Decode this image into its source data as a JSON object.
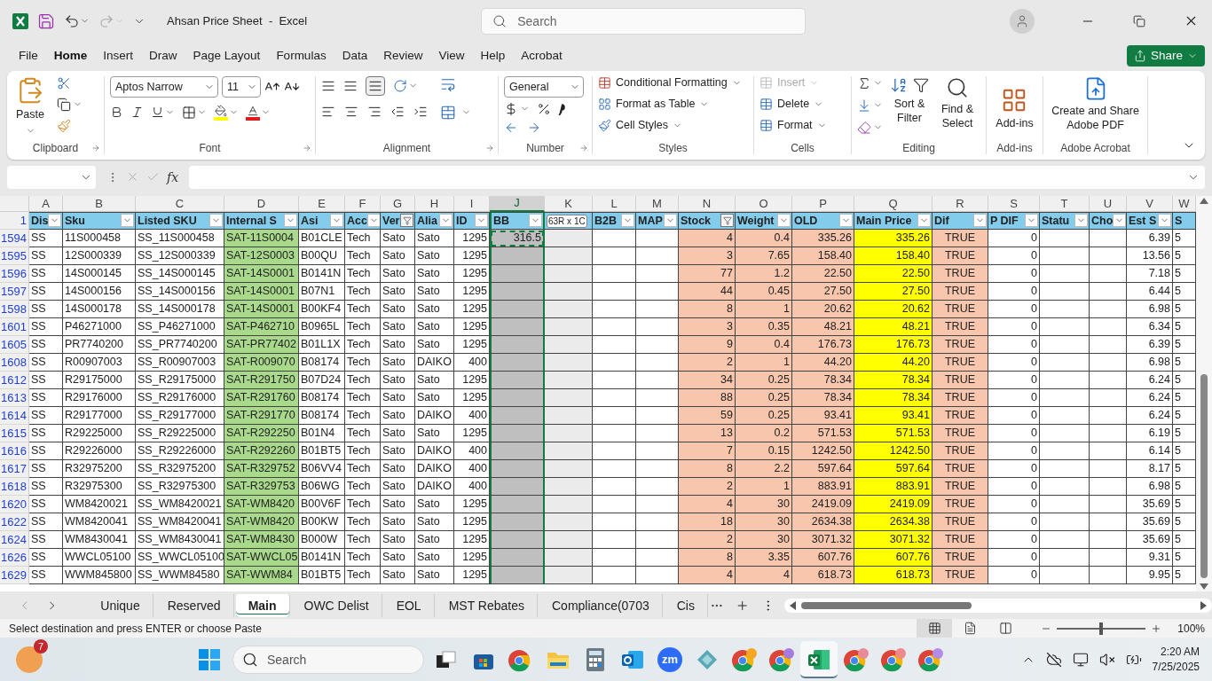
{
  "window": {
    "title": "Ahsan Price Sheet  -  Excel",
    "search_placeholder": "Search"
  },
  "menu_tabs": [
    {
      "label": "File",
      "selected": false
    },
    {
      "label": "Home",
      "selected": true
    },
    {
      "label": "Insert",
      "selected": false
    },
    {
      "label": "Draw",
      "selected": false
    },
    {
      "label": "Page Layout",
      "selected": false
    },
    {
      "label": "Formulas",
      "selected": false
    },
    {
      "label": "Data",
      "selected": false
    },
    {
      "label": "Review",
      "selected": false
    },
    {
      "label": "View",
      "selected": false
    },
    {
      "label": "Help",
      "selected": false
    },
    {
      "label": "Acrobat",
      "selected": false
    }
  ],
  "share_button": "Share",
  "ribbon": {
    "clipboard": {
      "label": "Clipboard",
      "paste": "Paste"
    },
    "font": {
      "label": "Font",
      "font_name": "Aptos Narrow",
      "font_size": "11"
    },
    "alignment": {
      "label": "Alignment"
    },
    "number": {
      "label": "Number",
      "format": "General"
    },
    "styles": {
      "label": "Styles",
      "items": [
        "Conditional Formatting",
        "Format as Table",
        "Cell Styles"
      ]
    },
    "cells": {
      "label": "Cells",
      "items": [
        {
          "label": "Insert",
          "disabled": true
        },
        {
          "label": "Delete",
          "disabled": false
        },
        {
          "label": "Format",
          "disabled": false
        }
      ]
    },
    "editing": {
      "label": "Editing",
      "sort": "Sort & Filter",
      "find": "Find & Select"
    },
    "addins": {
      "label": "Add-ins",
      "button": "Add-ins"
    },
    "acrobat": {
      "label": "Adobe Acrobat",
      "button": "Create and Share Adobe PDF"
    }
  },
  "formula_bar": {
    "fx": "fx"
  },
  "selection_tooltip": "63R x 1C",
  "table": {
    "columns": [
      {
        "letter": "A",
        "header": "Dis",
        "selected": false,
        "filtered": false
      },
      {
        "letter": "B",
        "header": "Sku",
        "selected": false,
        "filtered": false
      },
      {
        "letter": "C",
        "header": "Listed SKU",
        "selected": false,
        "filtered": false
      },
      {
        "letter": "D",
        "header": "Internal S",
        "selected": false,
        "filtered": false,
        "color": "#a9d98b"
      },
      {
        "letter": "E",
        "header": "Asi",
        "selected": false,
        "filtered": false
      },
      {
        "letter": "F",
        "header": "Acc",
        "selected": false,
        "filtered": false
      },
      {
        "letter": "G",
        "header": "Ver",
        "selected": false,
        "filtered": true
      },
      {
        "letter": "H",
        "header": "Alia",
        "selected": false,
        "filtered": false
      },
      {
        "letter": "I",
        "header": "ID",
        "selected": false,
        "filtered": false
      },
      {
        "letter": "J",
        "header": "BB",
        "selected": true,
        "filtered": false
      },
      {
        "letter": "K",
        "selected": false,
        "color": "#ebebeb"
      },
      {
        "letter": "L",
        "header": "B2B",
        "selected": false,
        "filtered": false
      },
      {
        "letter": "M",
        "header": "MAP",
        "selected": false,
        "filtered": false
      },
      {
        "letter": "N",
        "header": "Stock",
        "selected": false,
        "filtered": true,
        "color": "#f7c6ad"
      },
      {
        "letter": "O",
        "header": "Weight",
        "selected": false,
        "filtered": false,
        "color": "#f7c6ad"
      },
      {
        "letter": "P",
        "header": "OLD",
        "selected": false,
        "filtered": false,
        "color": "#f7c6ad"
      },
      {
        "letter": "Q",
        "header": "Main Price",
        "selected": false,
        "filtered": false,
        "color": "#ffff00"
      },
      {
        "letter": "R",
        "header": "Dif",
        "selected": false,
        "filtered": false,
        "color": "#f7c6ad"
      },
      {
        "letter": "S",
        "header": "P DIF",
        "selected": false,
        "filtered": false
      },
      {
        "letter": "T",
        "header": "Statu",
        "selected": false,
        "filtered": false
      },
      {
        "letter": "U",
        "header": "Cho",
        "selected": false,
        "filtered": false
      },
      {
        "letter": "V",
        "header": "Est S",
        "selected": false,
        "filtered": false
      },
      {
        "letter": "W",
        "header": "S",
        "selected": false
      }
    ],
    "header_row": "1",
    "rows": [
      {
        "row": "1594",
        "dist": "SS",
        "sku": "11S000458",
        "listed_sku": "SS_11S000458",
        "internal_sku": "SAT-11S0004",
        "asin": "B01CLE",
        "acct": "Tech",
        "vendor": "Sato",
        "alias": "Sato",
        "id": "1295",
        "bb": "316.5",
        "stock": "4",
        "weight": "0.4",
        "old": "335.26",
        "main_price": "335.26",
        "dif": "TRUE",
        "p_dif": "0",
        "est_s": "6.39",
        "col_w": "5"
      },
      {
        "row": "1595",
        "dist": "SS",
        "sku": "12S000339",
        "listed_sku": "SS_12S000339",
        "internal_sku": "SAT-12S0003",
        "asin": "B00QU",
        "acct": "Tech",
        "vendor": "Sato",
        "alias": "Sato",
        "id": "1295",
        "stock": "3",
        "weight": "7.65",
        "old": "158.40",
        "main_price": "158.40",
        "dif": "TRUE",
        "p_dif": "0",
        "est_s": "13.56",
        "col_w": "5"
      },
      {
        "row": "1596",
        "dist": "SS",
        "sku": "14S000145",
        "listed_sku": "SS_14S000145",
        "internal_sku": "SAT-14S0001",
        "asin": "B0141N",
        "acct": "Tech",
        "vendor": "Sato",
        "alias": "Sato",
        "id": "1295",
        "stock": "77",
        "weight": "1.2",
        "old": "22.50",
        "main_price": "22.50",
        "dif": "TRUE",
        "p_dif": "0",
        "est_s": "7.18",
        "col_w": "5"
      },
      {
        "row": "1597",
        "dist": "SS",
        "sku": "14S000156",
        "listed_sku": "SS_14S000156",
        "internal_sku": "SAT-14S0001",
        "asin": "B07N1",
        "acct": "Tech",
        "vendor": "Sato",
        "alias": "Sato",
        "id": "1295",
        "stock": "44",
        "weight": "0.45",
        "old": "27.50",
        "main_price": "27.50",
        "dif": "TRUE",
        "p_dif": "0",
        "est_s": "6.44",
        "col_w": "5"
      },
      {
        "row": "1598",
        "dist": "SS",
        "sku": "14S000178",
        "listed_sku": "SS_14S000178",
        "internal_sku": "SAT-14S0001",
        "asin": "B00KF4",
        "acct": "Tech",
        "vendor": "Sato",
        "alias": "Sato",
        "id": "1295",
        "stock": "8",
        "weight": "1",
        "old": "20.62",
        "main_price": "20.62",
        "dif": "TRUE",
        "p_dif": "0",
        "est_s": "6.98",
        "col_w": "5"
      },
      {
        "row": "1601",
        "dist": "SS",
        "sku": "P46271000",
        "listed_sku": "SS_P46271000",
        "internal_sku": "SAT-P462710",
        "asin": "B0965L",
        "acct": "Tech",
        "vendor": "Sato",
        "alias": "Sato",
        "id": "1295",
        "stock": "3",
        "weight": "0.35",
        "old": "48.21",
        "main_price": "48.21",
        "dif": "TRUE",
        "p_dif": "0",
        "est_s": "6.34",
        "col_w": "5"
      },
      {
        "row": "1605",
        "dist": "SS",
        "sku": "PR7740200",
        "listed_sku": "SS_PR7740200",
        "internal_sku": "SAT-PR77402",
        "asin": "B01L1X",
        "acct": "Tech",
        "vendor": "Sato",
        "alias": "Sato",
        "id": "1295",
        "stock": "9",
        "weight": "0.4",
        "old": "176.73",
        "main_price": "176.73",
        "dif": "TRUE",
        "p_dif": "0",
        "est_s": "6.39",
        "col_w": "5"
      },
      {
        "row": "1608",
        "dist": "SS",
        "sku": "R00907003",
        "listed_sku": "SS_R00907003",
        "internal_sku": "SAT-R009070",
        "asin": "B08174",
        "acct": "Tech",
        "vendor": "Sato",
        "alias": "DAIKO",
        "id": "400",
        "stock": "2",
        "weight": "1",
        "old": "44.20",
        "main_price": "44.20",
        "dif": "TRUE",
        "p_dif": "0",
        "est_s": "6.98",
        "col_w": "5"
      },
      {
        "row": "1612",
        "dist": "SS",
        "sku": "R29175000",
        "listed_sku": "SS_R29175000",
        "internal_sku": "SAT-R291750",
        "asin": "B07D24",
        "acct": "Tech",
        "vendor": "Sato",
        "alias": "Sato",
        "id": "1295",
        "stock": "34",
        "weight": "0.25",
        "old": "78.34",
        "main_price": "78.34",
        "dif": "TRUE",
        "p_dif": "0",
        "est_s": "6.24",
        "col_w": "5"
      },
      {
        "row": "1613",
        "dist": "SS",
        "sku": "R29176000",
        "listed_sku": "SS_R29176000",
        "internal_sku": "SAT-R291760",
        "asin": "B08174",
        "acct": "Tech",
        "vendor": "Sato",
        "alias": "Sato",
        "id": "1295",
        "stock": "88",
        "weight": "0.25",
        "old": "78.34",
        "main_price": "78.34",
        "dif": "TRUE",
        "p_dif": "0",
        "est_s": "6.24",
        "col_w": "5"
      },
      {
        "row": "1614",
        "dist": "SS",
        "sku": "R29177000",
        "listed_sku": "SS_R29177000",
        "internal_sku": "SAT-R291770",
        "asin": "B08174",
        "acct": "Tech",
        "vendor": "Sato",
        "alias": "DAIKO",
        "id": "400",
        "stock": "59",
        "weight": "0.25",
        "old": "93.41",
        "main_price": "93.41",
        "dif": "TRUE",
        "p_dif": "0",
        "est_s": "6.24",
        "col_w": "5"
      },
      {
        "row": "1615",
        "dist": "SS",
        "sku": "R29225000",
        "listed_sku": "SS_R29225000",
        "internal_sku": "SAT-R292250",
        "asin": "B01N4",
        "acct": "Tech",
        "vendor": "Sato",
        "alias": "Sato",
        "id": "1295",
        "stock": "13",
        "weight": "0.2",
        "old": "571.53",
        "main_price": "571.53",
        "dif": "TRUE",
        "p_dif": "0",
        "est_s": "6.19",
        "col_w": "5"
      },
      {
        "row": "1616",
        "dist": "SS",
        "sku": "R29226000",
        "listed_sku": "SS_R29226000",
        "internal_sku": "SAT-R292260",
        "asin": "B01BT5",
        "acct": "Tech",
        "vendor": "Sato",
        "alias": "DAIKO",
        "id": "400",
        "stock": "7",
        "weight": "0.15",
        "old": "1242.50",
        "main_price": "1242.50",
        "dif": "TRUE",
        "p_dif": "0",
        "est_s": "6.14",
        "col_w": "5"
      },
      {
        "row": "1617",
        "dist": "SS",
        "sku": "R32975200",
        "listed_sku": "SS_R32975200",
        "internal_sku": "SAT-R329752",
        "asin": "B06VV4",
        "acct": "Tech",
        "vendor": "Sato",
        "alias": "DAIKO",
        "id": "400",
        "stock": "8",
        "weight": "2.2",
        "old": "597.64",
        "main_price": "597.64",
        "dif": "TRUE",
        "p_dif": "0",
        "est_s": "8.17",
        "col_w": "5"
      },
      {
        "row": "1618",
        "dist": "SS",
        "sku": "R32975300",
        "listed_sku": "SS_R32975300",
        "internal_sku": "SAT-R329753",
        "asin": "B06WG",
        "acct": "Tech",
        "vendor": "Sato",
        "alias": "DAIKO",
        "id": "400",
        "stock": "2",
        "weight": "1",
        "old": "883.91",
        "main_price": "883.91",
        "dif": "TRUE",
        "p_dif": "0",
        "est_s": "6.98",
        "col_w": "5"
      },
      {
        "row": "1620",
        "dist": "SS",
        "sku": "WM8420021",
        "listed_sku": "SS_WM8420021",
        "internal_sku": "SAT-WM8420",
        "asin": "B00V6F",
        "acct": "Tech",
        "vendor": "Sato",
        "alias": "Sato",
        "id": "1295",
        "stock": "4",
        "weight": "30",
        "old": "2419.09",
        "main_price": "2419.09",
        "dif": "TRUE",
        "p_dif": "0",
        "est_s": "35.69",
        "col_w": "5"
      },
      {
        "row": "1622",
        "dist": "SS",
        "sku": "WM8420041",
        "listed_sku": "SS_WM8420041",
        "internal_sku": "SAT-WM8420",
        "asin": "B00KW",
        "acct": "Tech",
        "vendor": "Sato",
        "alias": "Sato",
        "id": "1295",
        "stock": "18",
        "weight": "30",
        "old": "2634.38",
        "main_price": "2634.38",
        "dif": "TRUE",
        "p_dif": "0",
        "est_s": "35.69",
        "col_w": "5"
      },
      {
        "row": "1624",
        "dist": "SS",
        "sku": "WM8430041",
        "listed_sku": "SS_WM8430041",
        "internal_sku": "SAT-WM8430",
        "asin": "B000W",
        "acct": "Tech",
        "vendor": "Sato",
        "alias": "Sato",
        "id": "1295",
        "stock": "2",
        "weight": "30",
        "old": "3071.32",
        "main_price": "3071.32",
        "dif": "TRUE",
        "p_dif": "0",
        "est_s": "35.69",
        "col_w": "5"
      },
      {
        "row": "1626",
        "dist": "SS",
        "sku": "WWCL05100",
        "listed_sku": "SS_WWCL05100",
        "internal_sku": "SAT-WWCL05",
        "asin": "B0141N",
        "acct": "Tech",
        "vendor": "Sato",
        "alias": "Sato",
        "id": "1295",
        "stock": "8",
        "weight": "3.35",
        "old": "607.76",
        "main_price": "607.76",
        "dif": "TRUE",
        "p_dif": "0",
        "est_s": "9.31",
        "col_w": "5"
      },
      {
        "row": "1629",
        "dist": "SS",
        "sku": "WWM845800",
        "listed_sku": "SS_WWM84580",
        "internal_sku": "SAT-WWM84",
        "asin": "B01BT5",
        "acct": "Tech",
        "vendor": "Sato",
        "alias": "Sato",
        "id": "1295",
        "stock": "4",
        "weight": "4",
        "old": "618.73",
        "main_price": "618.73",
        "dif": "TRUE",
        "p_dif": "0",
        "est_s": "9.95",
        "col_w": "5"
      }
    ]
  },
  "sheet_tabs": [
    {
      "label": "Unique",
      "selected": false
    },
    {
      "label": "Reserved",
      "selected": false
    },
    {
      "label": "Main",
      "selected": true
    },
    {
      "label": "OWC Delist",
      "selected": false
    },
    {
      "label": "EOL",
      "selected": false
    },
    {
      "label": "MST Rebates",
      "selected": false
    },
    {
      "label": "Compliance(0703",
      "selected": false
    },
    {
      "label": "Cis",
      "selected": false
    }
  ],
  "status_bar": {
    "message": "Select destination and press ENTER or choose Paste",
    "views": [
      {
        "kind": "normal",
        "selected": true
      },
      {
        "kind": "page_layout",
        "selected": false
      },
      {
        "kind": "page_break",
        "selected": false
      }
    ],
    "zoom": {
      "level": 0.5,
      "reading": "100%"
    }
  },
  "taskbar": {
    "widget_badge": "7",
    "search_placeholder": "Search",
    "apps": [
      {
        "kind": "taskview",
        "selected": false
      },
      {
        "kind": "store",
        "selected": false
      },
      {
        "kind": "chrome",
        "selected": false
      },
      {
        "kind": "folder",
        "selected": false
      },
      {
        "kind": "calculator",
        "selected": false
      },
      {
        "kind": "outlook",
        "selected": false
      },
      {
        "kind": "zoom",
        "label": "zm",
        "selected": false
      },
      {
        "kind": "diamond",
        "selected": false
      },
      {
        "kind": "chrome",
        "selected": false,
        "color": "#f5a623"
      },
      {
        "kind": "chrome",
        "selected": false,
        "color": "#a57be0"
      },
      {
        "kind": "excel",
        "selected": true
      },
      {
        "kind": "chrome",
        "selected": false,
        "color": "#e88a9a"
      },
      {
        "kind": "chrome",
        "selected": false,
        "color": "#f08a8a"
      },
      {
        "kind": "chrome",
        "selected": false,
        "color": "#b48be8"
      }
    ],
    "time": "2:20 AM",
    "date": "7/25/2025"
  }
}
